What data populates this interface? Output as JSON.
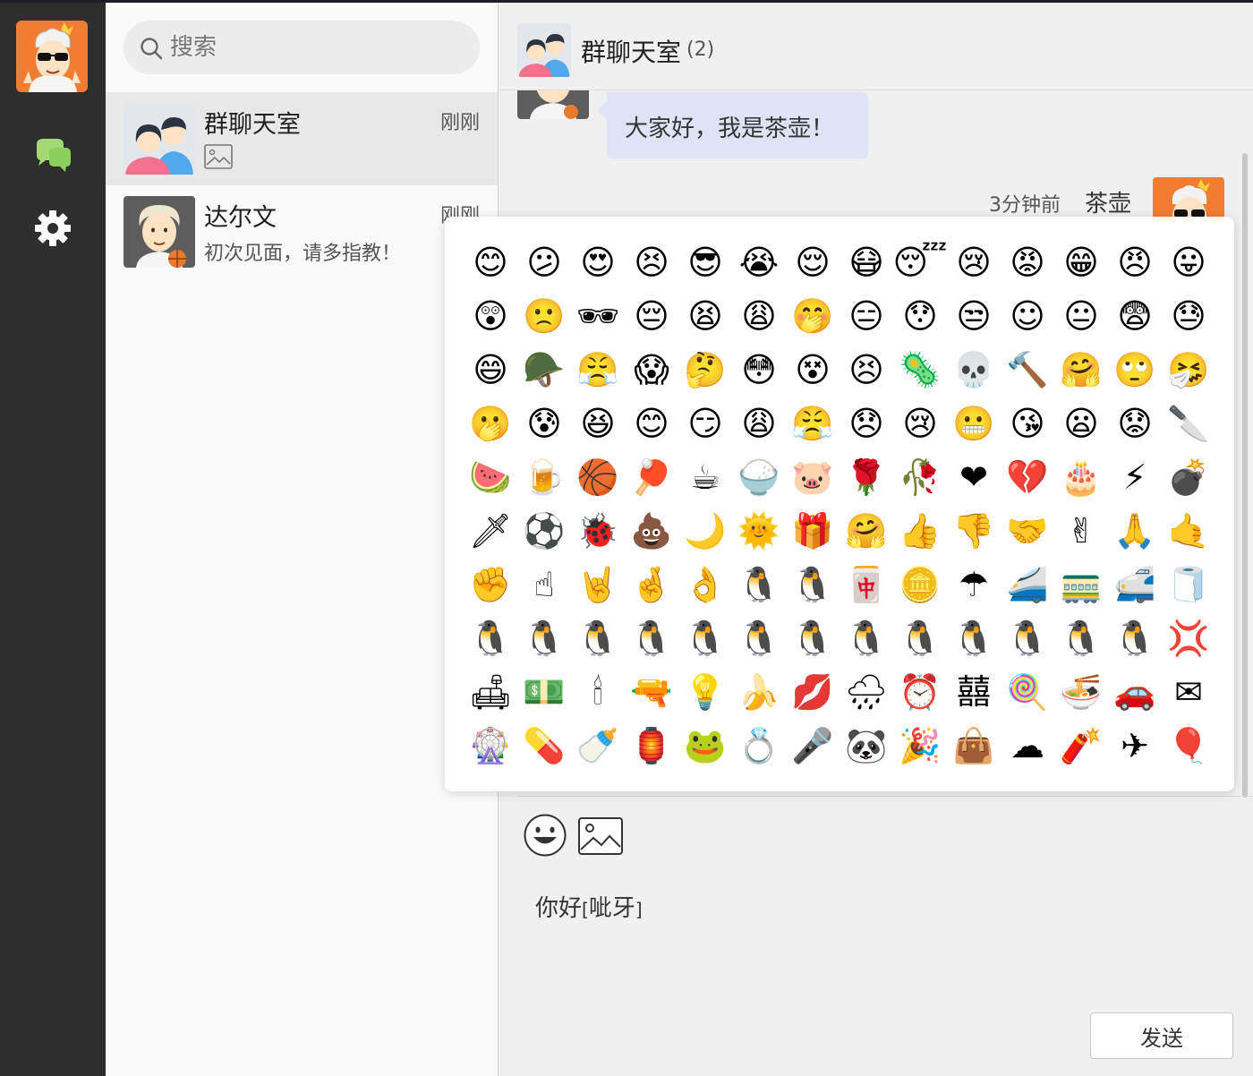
{
  "colors": {
    "rail_bg": "#2e2e2e",
    "list_bg": "#fafafa",
    "active_item_bg": "#e8e8e8",
    "chat_bg": "#f0f0f0",
    "incoming_bubble": "#dfe3f7",
    "accent_orange": "#f07d32",
    "chat_icon_green": "#a3d977"
  },
  "rail": {
    "avatar_icon": "user-avatar-cartoon",
    "chat_icon": "chat-bubbles-icon",
    "settings_icon": "gear-icon"
  },
  "search": {
    "placeholder": "搜索",
    "icon": "search-icon"
  },
  "conversations": [
    {
      "name": "群聊天室",
      "time": "刚刚",
      "preview": "",
      "preview_icon": "image-icon",
      "avatar": "group-avatar",
      "active": true
    },
    {
      "name": "达尔文",
      "time": "刚刚",
      "preview": "初次见面，请多指教！",
      "avatar": "darwin-avatar",
      "active": false
    }
  ],
  "chat": {
    "title": "群聊天室",
    "member_count": "(2)",
    "messages": [
      {
        "direction": "in",
        "text": "大家好，我是茶壶！"
      },
      {
        "direction": "out",
        "time": "3分钟前",
        "sender": "茶壶"
      }
    ]
  },
  "emoji_panel": {
    "rows": [
      [
        "😊",
        "😕",
        "😍",
        "😣",
        "😎",
        "😭",
        "😌",
        "😷",
        "😴",
        "😢",
        "😡",
        "😁",
        "😠",
        "😛"
      ],
      [
        "😲",
        "🙁",
        "🕶",
        "😔",
        "😫",
        "😩",
        "🤭",
        "😑",
        "😯",
        "😒",
        "☺",
        "😐",
        "😨",
        "😓"
      ],
      [
        "😄",
        "🪖",
        "😤",
        "😱",
        "🤔",
        "😳",
        "😵",
        "😣",
        "🦠",
        "💀",
        "🔨",
        "🤗",
        "🙄",
        "🤧"
      ],
      [
        "🫢",
        "😰",
        "😆",
        "😊",
        "😏",
        "😩",
        "😤",
        "😞",
        "😢",
        "😬",
        "😘",
        "😦",
        "😟",
        "🔪"
      ],
      [
        "🍉",
        "🍺",
        "🏀",
        "🏓",
        "☕",
        "🍚",
        "🐷",
        "🌹",
        "🥀",
        "❤",
        "💔",
        "🎂",
        "⚡",
        "💣"
      ],
      [
        "🗡",
        "⚽",
        "🐞",
        "💩",
        "🌙",
        "🌞",
        "🎁",
        "🤗",
        "👍",
        "👎",
        "🤝",
        "✌",
        "🙏",
        "🤙"
      ],
      [
        "✊",
        "☝",
        "🤘",
        "🤞",
        "👌",
        "🐧",
        "🐧",
        "🀄",
        "🪙",
        "☂",
        "🚄",
        "🚃",
        "🚅",
        "🧻"
      ],
      [
        "🐧",
        "🐧",
        "🐧",
        "🐧",
        "🐧",
        "🐧",
        "🐧",
        "🐧",
        "🐧",
        "🐧",
        "🐧",
        "🐧",
        "🐧",
        "💢"
      ],
      [
        "🛋",
        "💵",
        "🕯",
        "🔫",
        "💡",
        "🍌",
        "💋",
        "🌧",
        "⏰",
        "囍",
        "🍭",
        "🍜",
        "🚗",
        "✉"
      ],
      [
        "🎡",
        "💊",
        "🍼",
        "🏮",
        "🐸",
        "💍",
        "🎤",
        "🐼",
        "🎉",
        "👜",
        "☁",
        "🧨",
        "✈",
        "🎈"
      ]
    ]
  },
  "composer": {
    "emoji_button_icon": "smiley-icon",
    "image_button_icon": "image-icon",
    "text_before": "你好",
    "text_tag": "呲牙",
    "send_label": "发送"
  }
}
